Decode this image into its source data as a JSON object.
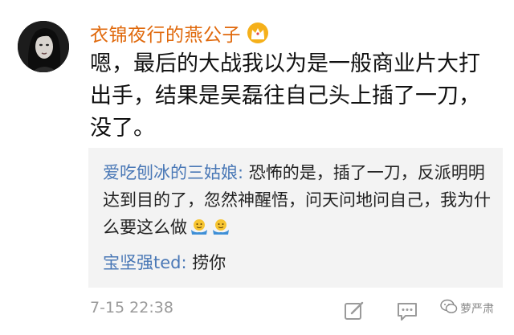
{
  "comment": {
    "username": "衣锦夜行的燕公子",
    "badge_icon": "crown-icon",
    "text": "嗯，最后的大战我以为是一般商业片大打出手，结果是吴磊往自己头上插了一刀，没了。",
    "timestamp": "7-15 22:38"
  },
  "replies": [
    {
      "user": "爱吃刨冰的三姑娘:",
      "text": " 恐怖的是，插了一刀，反派明明达到目的了，忽然神醒悟，问天问地问自己，我为什么要这么做",
      "emoji": "shrug-emoji"
    },
    {
      "user": "宝坚强ted:",
      "text": " 捞你"
    }
  ],
  "actions": [
    "edit-icon",
    "comment-icon"
  ],
  "watermark": {
    "text": "萝严肃"
  },
  "colors": {
    "username": "#e0690c",
    "reply_user": "#4a78b6",
    "reply_bg": "#f3f3f3",
    "timestamp": "#9a9a9a"
  }
}
